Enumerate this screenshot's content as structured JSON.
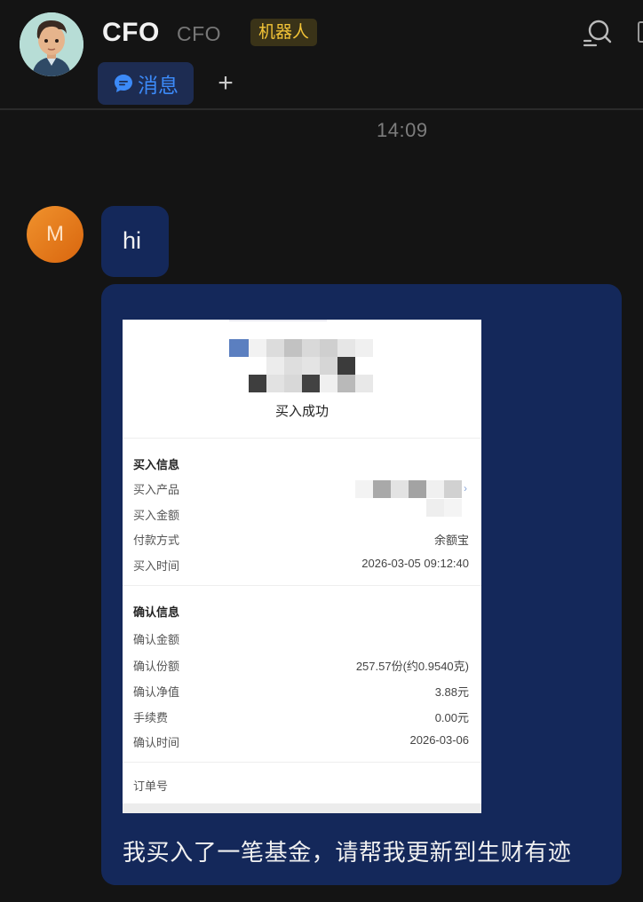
{
  "header": {
    "title": "CFO",
    "subtitle": "CFO",
    "badge": "机器人",
    "tab_label": "消息",
    "add_tab": "+"
  },
  "chat": {
    "timestamp": "14:09",
    "user_initial": "M",
    "messages": [
      {
        "text": "hi"
      },
      {
        "text": "我买入了一笔基金，请帮我更新到生财有迹"
      }
    ]
  },
  "receipt": {
    "status": "买入成功",
    "purchase_section": {
      "heading": "买入信息",
      "rows": [
        {
          "label": "买入产品",
          "value": ""
        },
        {
          "label": "买入金额",
          "value": ""
        },
        {
          "label": "付款方式",
          "value": "余额宝"
        },
        {
          "label": "买入时间",
          "value": "2026-03-05 09:12:40"
        }
      ]
    },
    "confirm_section": {
      "heading": "确认信息",
      "rows": [
        {
          "label": "确认金额",
          "value": ""
        },
        {
          "label": "确认份额",
          "value": "257.57份(约0.9540克)"
        },
        {
          "label": "确认净值",
          "value": "3.88元"
        },
        {
          "label": "手续费",
          "value": "0.00元"
        },
        {
          "label": "确认时间",
          "value": "2026-03-06"
        }
      ]
    },
    "order_label": "订单号"
  },
  "colors": {
    "background": "#141414",
    "bubble": "#14285a",
    "accent": "#3c8af8",
    "badge_text": "#f3c437"
  },
  "icons": [
    "avatar",
    "search-icon",
    "chat-bubble-icon",
    "add-icon"
  ]
}
